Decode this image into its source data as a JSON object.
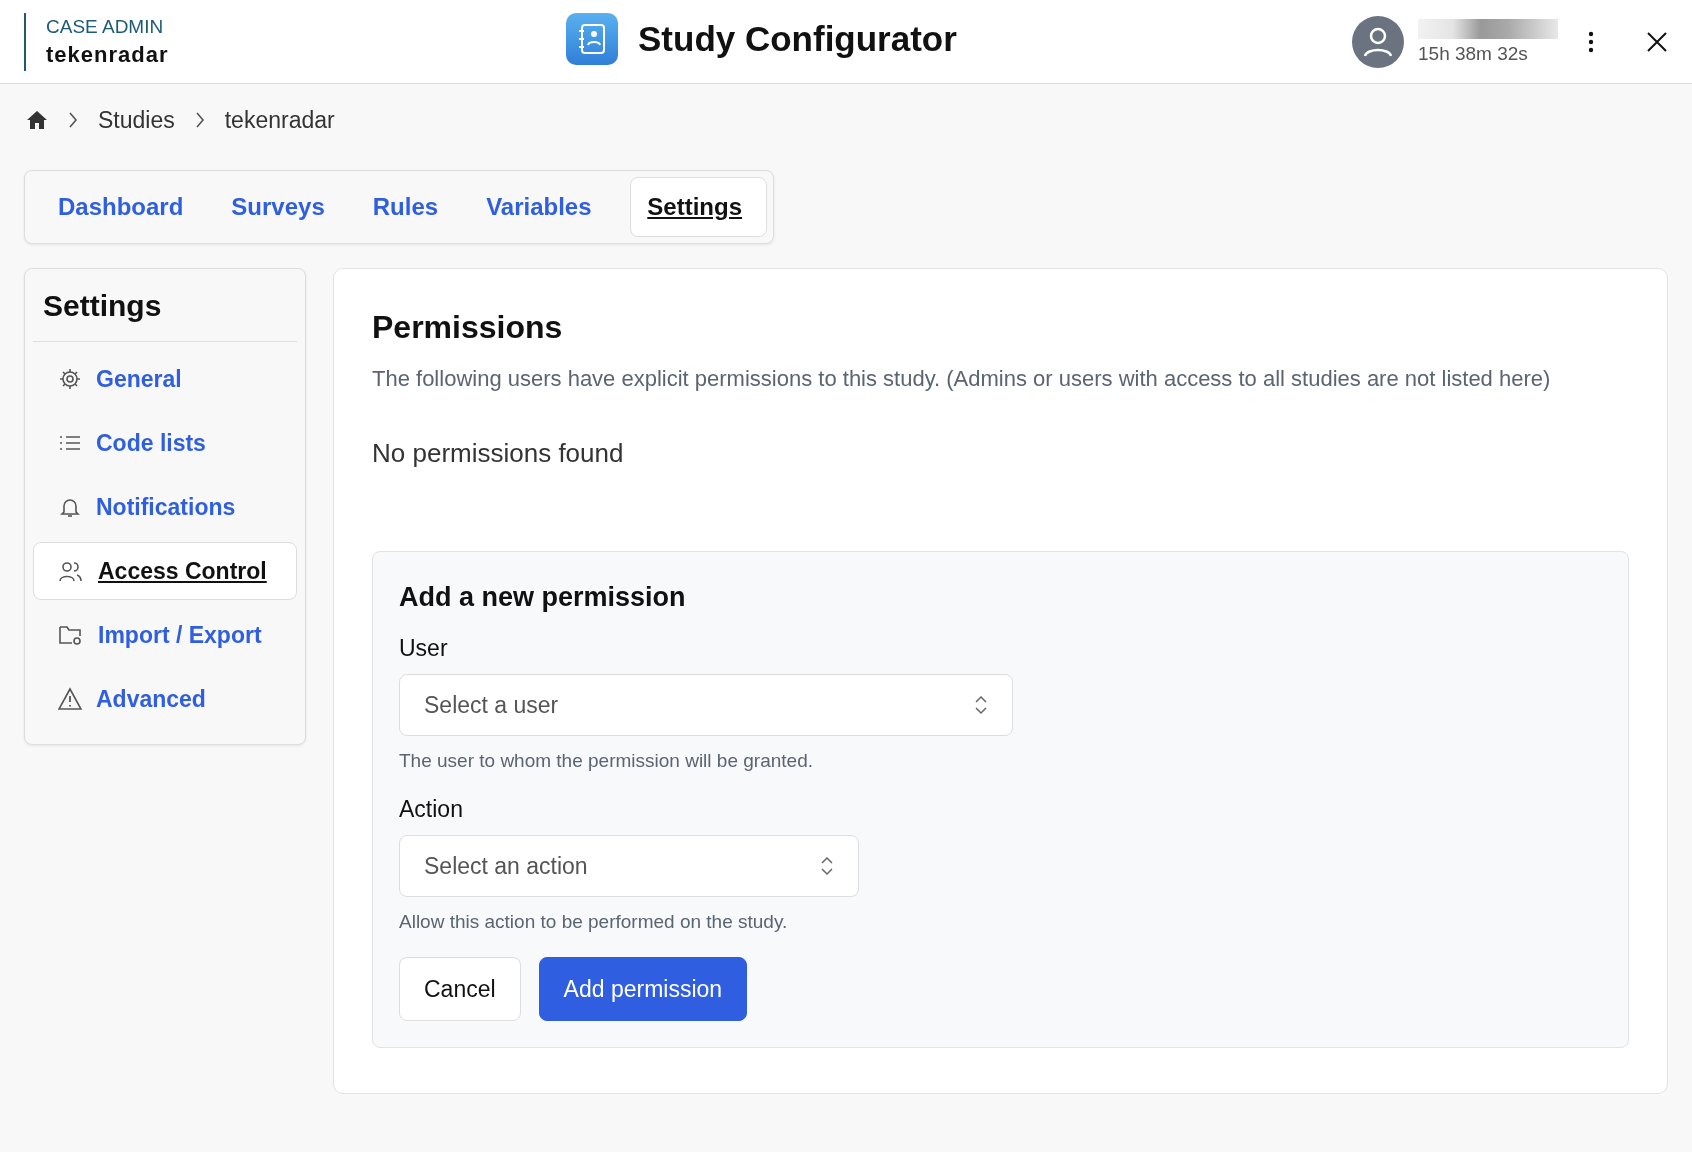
{
  "header": {
    "overline": "CASE ADMIN",
    "app_name": "tekenradar",
    "title": "Study Configurator",
    "session_timer": "15h 38m 32s"
  },
  "breadcrumbs": [
    "Studies",
    "tekenradar"
  ],
  "tabs": [
    {
      "label": "Dashboard",
      "selected": false
    },
    {
      "label": "Surveys",
      "selected": false
    },
    {
      "label": "Rules",
      "selected": false
    },
    {
      "label": "Variables",
      "selected": false
    },
    {
      "label": "Settings",
      "selected": true
    }
  ],
  "sidebar": {
    "title": "Settings",
    "items": [
      {
        "label": "General",
        "kind": "gear",
        "selected": false
      },
      {
        "label": "Code lists",
        "kind": "list",
        "selected": false
      },
      {
        "label": "Notifications",
        "kind": "bell",
        "selected": false
      },
      {
        "label": "Access Control",
        "kind": "users",
        "selected": true
      },
      {
        "label": "Import / Export",
        "kind": "folder",
        "selected": false
      },
      {
        "label": "Advanced",
        "kind": "warning",
        "selected": false
      }
    ]
  },
  "permissions": {
    "title": "Permissions",
    "description": "The following users have explicit permissions to this study. (Admins or users with access to all studies are not listed here)",
    "empty_message": "No permissions found"
  },
  "form": {
    "title": "Add a new permission",
    "fields": [
      {
        "label": "User",
        "placeholder": "Select a user",
        "help": "The user to whom the permission will be granted."
      },
      {
        "label": "Action",
        "placeholder": "Select an action",
        "help": "Allow this action to be performed on the study."
      }
    ],
    "buttons": [
      {
        "label": "Cancel",
        "kind": "secondary"
      },
      {
        "label": "Add permission",
        "kind": "primary"
      }
    ]
  }
}
